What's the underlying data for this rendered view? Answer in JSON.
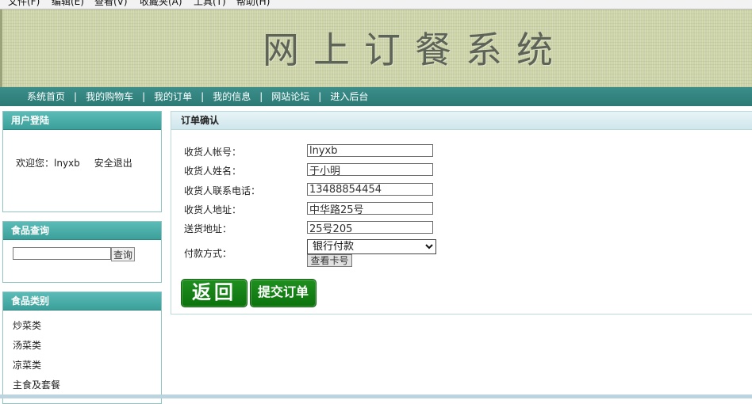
{
  "browser_menu": [
    "文件(F)",
    "编辑(E)",
    "查看(V)",
    "收藏夹(A)",
    "工具(T)",
    "帮助(H)"
  ],
  "banner": {
    "title": "网上订餐系统"
  },
  "nav": {
    "items": [
      "系统首页",
      "我的购物车",
      "我的订单",
      "我的信息",
      "网站论坛",
      "进入后台"
    ],
    "separator": "|"
  },
  "login_box": {
    "title": "用户登陆",
    "welcome": "欢迎您：lnyxb",
    "logout": "安全退出"
  },
  "search_box": {
    "title": "食品查询",
    "input_value": "",
    "button": "查询"
  },
  "category_box": {
    "title": "食品类别",
    "items": [
      "炒菜类",
      "汤菜类",
      "凉菜类",
      "主食及套餐"
    ]
  },
  "order": {
    "title": "订单确认",
    "fields": [
      {
        "label": "收货人帐号：",
        "value": "lnyxb"
      },
      {
        "label": "收货人姓名：",
        "value": "于小明"
      },
      {
        "label": "收货人联系电话：",
        "value": "13488854454"
      },
      {
        "label": "收货人地址：",
        "value": "中华路25号"
      },
      {
        "label": "送货地址：",
        "value": "25号205"
      }
    ],
    "payment_label": "付款方式：",
    "payment_selected": "银行付款",
    "view_card_button": "查看卡号",
    "back_button": "返回",
    "submit_button": "提交订单"
  },
  "colors": {
    "nav": "#2f7f7b",
    "box_header": "#4aaea9",
    "green_button": "#14801a",
    "banner": "#cdd3a9"
  }
}
